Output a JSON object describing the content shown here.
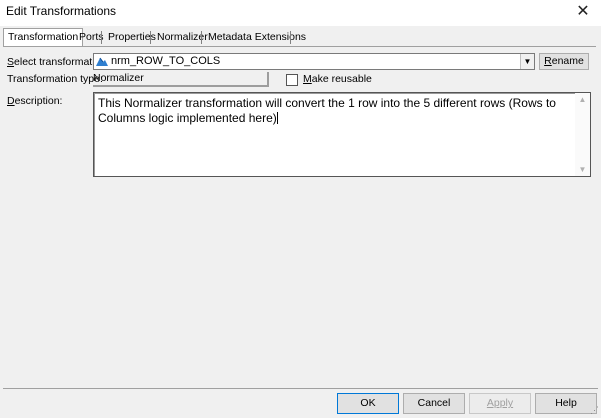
{
  "window": {
    "title": "Edit Transformations",
    "close_glyph": "✕"
  },
  "tabs": [
    {
      "label": "Transformation"
    },
    {
      "label": "Ports"
    },
    {
      "label": "Properties"
    },
    {
      "label": "Normalizer"
    },
    {
      "label": "Metadata Extensions"
    }
  ],
  "form": {
    "select_label_u": "S",
    "select_label_rest": "elect transformation:",
    "select_value": "nrm_ROW_TO_COLS",
    "select_icon": "normalizer-transformation-icon",
    "rename_u": "R",
    "rename_rest": "ename",
    "type_label": "Transformation type:",
    "type_value": "Normalizer",
    "reusable_u": "M",
    "reusable_rest": "ake reusable",
    "reusable_checked": false,
    "desc_label_u": "D",
    "desc_label_rest": "escription:",
    "description": "This Normalizer transformation will convert the 1 row into the 5 different rows (Rows to Columns logic implemented here)"
  },
  "buttons": {
    "ok": "OK",
    "cancel": "Cancel",
    "apply": "Apply",
    "help": "Help"
  },
  "colors": {
    "tab_active_bg": "#ffffff",
    "button_bg": "#e1e1e1",
    "disabled_text": "#a0a0a0"
  }
}
